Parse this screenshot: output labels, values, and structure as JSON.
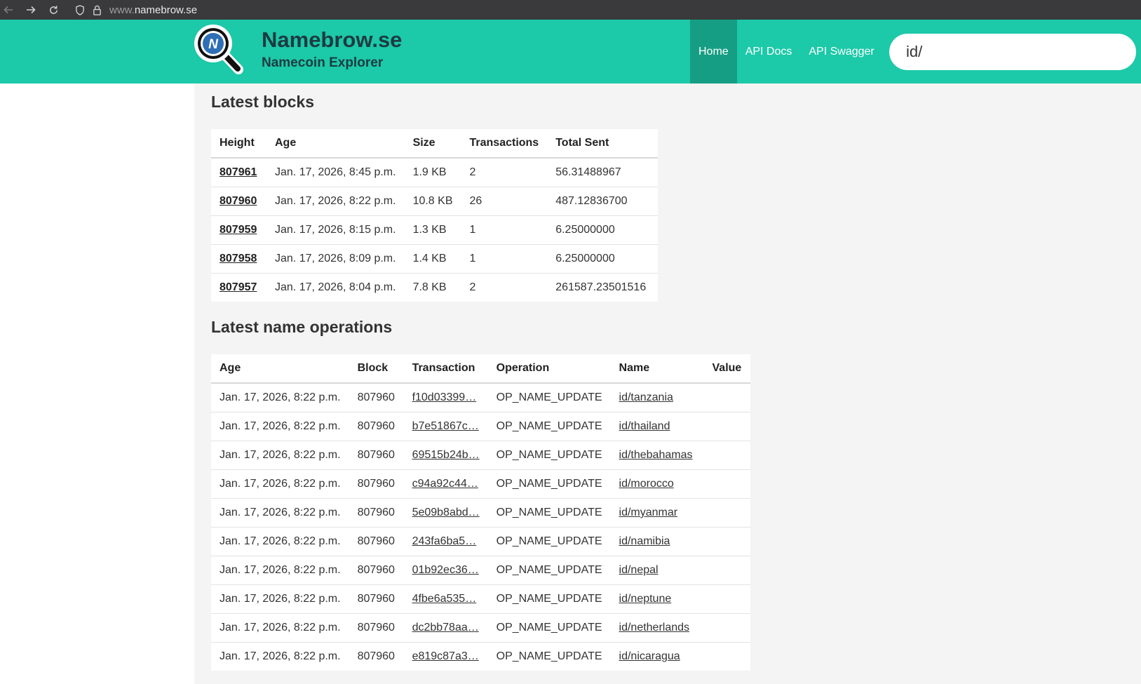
{
  "browser": {
    "url_prefix": "www.",
    "url_domain": "namebrow.se"
  },
  "header": {
    "title": "Namebrow.se",
    "subtitle": "Namecoin Explorer",
    "logo_letter": "N",
    "nav": [
      {
        "label": "Home",
        "active": true
      },
      {
        "label": "API Docs",
        "active": false
      },
      {
        "label": "API Swagger",
        "active": false
      }
    ],
    "search_value": "id/"
  },
  "colors": {
    "header_bg": "#1cc9a8",
    "nav_active_bg": "#169e84",
    "brand_text": "#1d3b42"
  },
  "blocks": {
    "heading": "Latest blocks",
    "columns": [
      "Height",
      "Age",
      "Size",
      "Transactions",
      "Total Sent"
    ],
    "rows": [
      {
        "height": "807961",
        "age": "Jan. 17, 2026, 8:45 p.m.",
        "size": "1.9 KB",
        "tx": "2",
        "sent": "56.31488967"
      },
      {
        "height": "807960",
        "age": "Jan. 17, 2026, 8:22 p.m.",
        "size": "10.8 KB",
        "tx": "26",
        "sent": "487.12836700"
      },
      {
        "height": "807959",
        "age": "Jan. 17, 2026, 8:15 p.m.",
        "size": "1.3 KB",
        "tx": "1",
        "sent": "6.25000000"
      },
      {
        "height": "807958",
        "age": "Jan. 17, 2026, 8:09 p.m.",
        "size": "1.4 KB",
        "tx": "1",
        "sent": "6.25000000"
      },
      {
        "height": "807957",
        "age": "Jan. 17, 2026, 8:04 p.m.",
        "size": "7.8 KB",
        "tx": "2",
        "sent": "261587.23501516"
      }
    ]
  },
  "names": {
    "heading": "Latest name operations",
    "columns": [
      "Age",
      "Block",
      "Transaction",
      "Operation",
      "Name",
      "Value"
    ],
    "rows": [
      {
        "age": "Jan. 17, 2026, 8:22 p.m.",
        "block": "807960",
        "tx": "f10d03399…",
        "op": "OP_NAME_UPDATE",
        "name": "id/tanzania",
        "value": ""
      },
      {
        "age": "Jan. 17, 2026, 8:22 p.m.",
        "block": "807960",
        "tx": "b7e51867c…",
        "op": "OP_NAME_UPDATE",
        "name": "id/thailand",
        "value": ""
      },
      {
        "age": "Jan. 17, 2026, 8:22 p.m.",
        "block": "807960",
        "tx": "69515b24b…",
        "op": "OP_NAME_UPDATE",
        "name": "id/thebahamas",
        "value": ""
      },
      {
        "age": "Jan. 17, 2026, 8:22 p.m.",
        "block": "807960",
        "tx": "c94a92c44…",
        "op": "OP_NAME_UPDATE",
        "name": "id/morocco",
        "value": ""
      },
      {
        "age": "Jan. 17, 2026, 8:22 p.m.",
        "block": "807960",
        "tx": "5e09b8abd…",
        "op": "OP_NAME_UPDATE",
        "name": "id/myanmar",
        "value": ""
      },
      {
        "age": "Jan. 17, 2026, 8:22 p.m.",
        "block": "807960",
        "tx": "243fa6ba5…",
        "op": "OP_NAME_UPDATE",
        "name": "id/namibia",
        "value": ""
      },
      {
        "age": "Jan. 17, 2026, 8:22 p.m.",
        "block": "807960",
        "tx": "01b92ec36…",
        "op": "OP_NAME_UPDATE",
        "name": "id/nepal",
        "value": ""
      },
      {
        "age": "Jan. 17, 2026, 8:22 p.m.",
        "block": "807960",
        "tx": "4fbe6a535…",
        "op": "OP_NAME_UPDATE",
        "name": "id/neptune",
        "value": ""
      },
      {
        "age": "Jan. 17, 2026, 8:22 p.m.",
        "block": "807960",
        "tx": "dc2bb78aa…",
        "op": "OP_NAME_UPDATE",
        "name": "id/netherlands",
        "value": ""
      },
      {
        "age": "Jan. 17, 2026, 8:22 p.m.",
        "block": "807960",
        "tx": "e819c87a3…",
        "op": "OP_NAME_UPDATE",
        "name": "id/nicaragua",
        "value": ""
      }
    ]
  }
}
